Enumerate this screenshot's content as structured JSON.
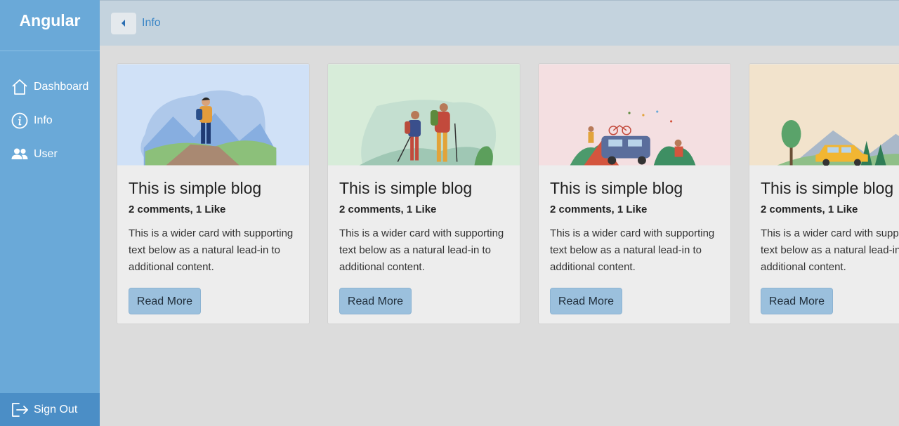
{
  "brand": "Angular",
  "nav": [
    {
      "label": "Dashboard",
      "icon": "home-icon"
    },
    {
      "label": "Info",
      "icon": "info-icon"
    },
    {
      "label": "User",
      "icon": "users-icon"
    }
  ],
  "signout": {
    "label": "Sign Out",
    "icon": "sign-out-icon"
  },
  "breadcrumb": {
    "label": "Info"
  },
  "cards": [
    {
      "title": "This is simple blog",
      "meta": "2 comments, 1 Like",
      "text": "This is a wider card with supporting text below as a natural lead-in to additional content.",
      "button": "Read More",
      "bg": "#d0e1f7"
    },
    {
      "title": "This is simple blog",
      "meta": "2 comments, 1 Like",
      "text": "This is a wider card with supporting text below as a natural lead-in to additional content.",
      "button": "Read More",
      "bg": "#d7ecd9"
    },
    {
      "title": "This is simple blog",
      "meta": "2 comments, 1 Like",
      "text": "This is a wider card with supporting text below as a natural lead-in to additional content.",
      "button": "Read More",
      "bg": "#f4dfe1"
    },
    {
      "title": "This is simple blog",
      "meta": "2 comments, 1 Like",
      "text": "This is a wider card with supporting text below as a natural lead-in to additional content.",
      "button": "Read More",
      "bg": "#f2e3cc"
    }
  ],
  "colors": {
    "sidebar": "#6aa9d8",
    "signout": "#4b8ec6",
    "topbar": "#c4d3de",
    "accent": "#3b86c6",
    "button": "#9bc0dd"
  }
}
